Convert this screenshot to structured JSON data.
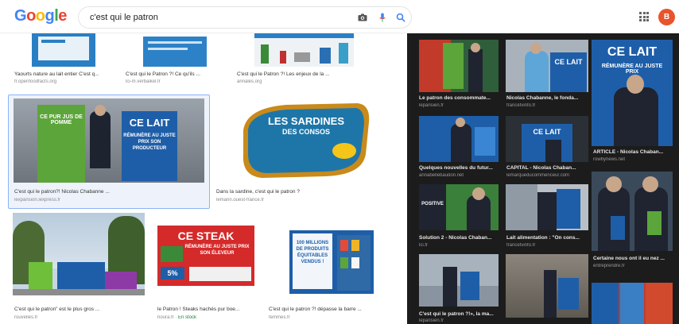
{
  "header": {
    "logo_letters": [
      {
        "ch": "G",
        "color": "#4285f4"
      },
      {
        "ch": "o",
        "color": "#ea4335"
      },
      {
        "ch": "o",
        "color": "#fbbc05"
      },
      {
        "ch": "g",
        "color": "#4285f4"
      },
      {
        "ch": "l",
        "color": "#34a853"
      },
      {
        "ch": "e",
        "color": "#ea4335"
      }
    ],
    "query": "c'est qui le patron",
    "icons": [
      "camera-icon",
      "microphone-icon",
      "search-icon",
      "apps-grid-icon"
    ],
    "avatar_letter": "B",
    "avatar_color": "#e8542c"
  },
  "left_results": [
    {
      "caption": "Yaourts nature au lait entier C'est q...",
      "source": "fr.openfoodfacts.org"
    },
    {
      "caption": "C'est qui le Patron ?! Ce qu'ils ...",
      "source": "lci-m.verbalkel.fr"
    },
    {
      "caption": "C'est qui le Patron ?! Les enjeux de la ...",
      "source": "annales.org"
    },
    {
      "caption": "C'est qui le patron?! Nicolas Chabanne ...",
      "source": "lexpansion.lexpress.fr"
    },
    {
      "caption": "Dans la sardine, c'est qui le patron ?",
      "source": "lemarin.ouest-france.fr"
    },
    {
      "caption": "C'est qui le patron\" est le plus gros ...",
      "source": "rouvelles.fr"
    },
    {
      "caption": "le Patron ! Steaks hachés pur boe...",
      "source": "houra.fr",
      "stock": "En stock"
    },
    {
      "caption": "C'est qui le patron ?! dépasse la barre ...",
      "source": "femmes.fr"
    }
  ],
  "tile_texts": {
    "banner_text_1": "CE PUR JUS DE POMME",
    "banner_text_2": "CE LAIT",
    "banner_text_3": "RÉMUNÈRE AU JUSTE PRIX SON PRODUCTEUR",
    "sardines_line_1": "LES SARDINES",
    "sardines_line_2": "DES CONSOS",
    "steak_title": "CE STEAK",
    "steak_sub": "RÉMUNÈRE AU JUSTE PRIX SON ÉLEVEUR",
    "steak_price": "5%",
    "millions_text": "100 MILLIONS DE PRODUITS ÉQUITABLES VENDUS !"
  },
  "right_results": [
    {
      "caption": "Le patron des consommate...",
      "source": "leparisien.fr"
    },
    {
      "caption": "Nicolas Chabanne, le fonda...",
      "source": "francetvinfo.fr"
    },
    {
      "caption": "ARTICLE - Nicolas Chaban...",
      "source": "rowbynews.net"
    },
    {
      "caption": "Quelques nouvelles du futur...",
      "source": "annabellebaudon.net"
    },
    {
      "caption": "CAPITAL - Nicolas Chaban...",
      "source": "lemarqueducommenceur.com"
    },
    {
      "caption": "Solution 2 - Nicolas Chaban...",
      "source": "lci.fr"
    },
    {
      "caption": "Lait alimentation : \"On cons...",
      "source": "francetvinfo.fr"
    },
    {
      "caption": "Certaine nous ont il eu nez ...",
      "source": "entreprendre.fr"
    },
    {
      "caption": "C'est qui le patron ?!», la ma...",
      "source": "leparisien.fr"
    }
  ],
  "right_tile_texts": {
    "ce_lait": "CE LAIT",
    "ce_lait_sub": "RÉMUNÈRE AU JUSTE PRIX",
    "steaks_big": "CE LAIT",
    "positive": "POSITIVE"
  },
  "colors": {
    "panel_bg": "#1c1c1c",
    "sign_blue": "#1e5ea8",
    "selected_border": "#8ab4f8"
  }
}
